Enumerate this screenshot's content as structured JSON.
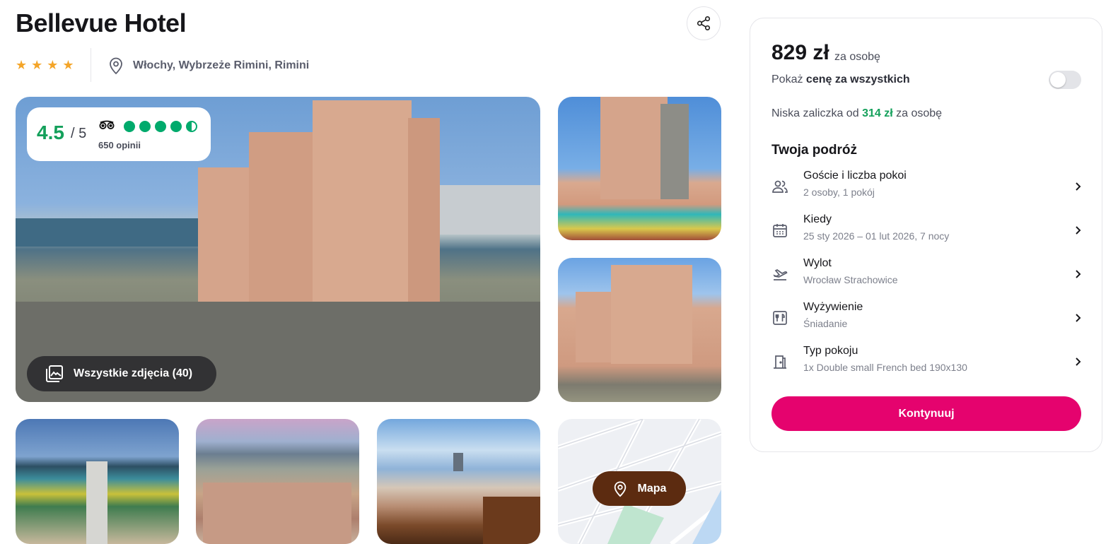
{
  "hotel": {
    "name": "Bellevue Hotel",
    "stars": 4,
    "star_glyph": "★",
    "location": "Włochy, Wybrzeże Rimini, Rimini"
  },
  "icons": {
    "share": "share-icon",
    "location": "location-pin-icon",
    "photos": "gallery-icon",
    "map": "map-pin-icon",
    "guests": "people-icon",
    "calendar": "calendar-icon",
    "flight": "plane-departure-icon",
    "meals": "cutlery-icon",
    "room": "door-icon",
    "chevron": "chevron-right-icon"
  },
  "rating": {
    "score": "4.5",
    "max": "/ 5",
    "tripadvisor_bubbles": 4.5,
    "reviews": "650 opinii"
  },
  "gallery": {
    "all_photos_label": "Wszystkie zdjęcia (40)",
    "map_label": "Mapa"
  },
  "booking": {
    "price": "829 zł",
    "price_unit": "za osobę",
    "toggle_prefix": "Pokaż",
    "toggle_bold": "cenę za wszystkich",
    "toggle_on": false,
    "deposit_prefix": "Niska zaliczka od",
    "deposit_amount": "314 zł",
    "deposit_suffix": "za osobę",
    "trip_title": "Twoja podróż",
    "items": [
      {
        "label": "Goście i liczba pokoi",
        "value": "2 osoby, 1 pokój"
      },
      {
        "label": "Kiedy",
        "value": "25 sty 2026 – 01 lut 2026, 7 nocy"
      },
      {
        "label": "Wylot",
        "value": "Wrocław Strachowice"
      },
      {
        "label": "Wyżywienie",
        "value": "Śniadanie"
      },
      {
        "label": "Typ pokoju",
        "value": "1x Double small French bed 190x130"
      }
    ],
    "continue_label": "Kontynuuj"
  },
  "colors": {
    "accent": "#e5036e",
    "rating_green": "#14a05b",
    "tripadvisor_green": "#00aa6c",
    "star": "#f4a529",
    "map_button": "#5c2b10"
  }
}
